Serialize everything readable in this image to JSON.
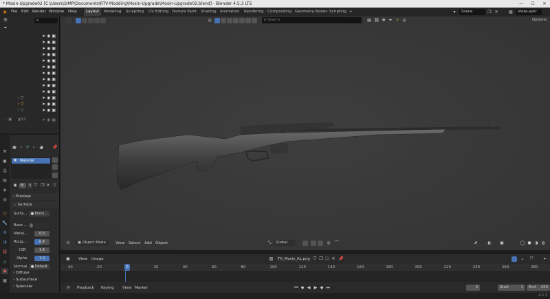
{
  "window": {
    "title": "* Mosin-Upgrade02 [C:\\Users\\SIMP\\Documents\\RTV-Modding\\Mosin-Upgrade\\Mosin-Upgrade02.blend] - Blender 4.5.3 LTS",
    "controls": {
      "minimize": "—",
      "maximize": "☐",
      "close": "✕"
    }
  },
  "menubar": {
    "items": [
      "File",
      "Edit",
      "Render",
      "Window",
      "Help"
    ]
  },
  "workspaces": {
    "tabs": [
      "Layout",
      "Modeling",
      "Sculpting",
      "UV Editing",
      "Texture Paint",
      "Shading",
      "Animation",
      "Rendering",
      "Compositing",
      "Geometry Nodes",
      "Scripting"
    ],
    "active": "Layout",
    "add": "+"
  },
  "scene": {
    "label": "Scene"
  },
  "view_layer": {
    "label": "ViewLayer"
  },
  "outliner": {
    "search_placeholder": "",
    "bottom_item": "gl11"
  },
  "properties": {
    "material_slot": "Material",
    "material_name": "M",
    "material_users": "3",
    "sections": {
      "preview": "Preview",
      "surface": "Surface"
    },
    "surface_label": "Surfa...",
    "surface_value": "Princi...",
    "rows": [
      {
        "label": "Base ...",
        "value": ""
      },
      {
        "label": "Metal...",
        "value": "0.0"
      },
      {
        "label": "Roug...",
        "value": "0.4"
      },
      {
        "label": "IOR",
        "value": "1.4"
      },
      {
        "label": "Alpha",
        "value": "1.0"
      },
      {
        "label": "Normal",
        "value": "Default"
      }
    ],
    "subsections": [
      "Diffuse",
      "Subsurface",
      "Specular"
    ]
  },
  "viewport": {
    "header_search_placeholder": "Search",
    "options_label": "Options",
    "mode": "Object Mode",
    "footer_menus": [
      "View",
      "Select",
      "Add",
      "Object"
    ],
    "orientation": "Global"
  },
  "image_header": {
    "menus": [
      "View",
      "Image"
    ],
    "image_name": "TX_Mosin_AL.png"
  },
  "timeline": {
    "ticks": [
      "-40",
      "-20",
      "0",
      "20",
      "40",
      "60",
      "80",
      "100",
      "120",
      "140",
      "160",
      "180",
      "200",
      "220",
      "240",
      "260",
      "280"
    ],
    "current_frame_marker": "0",
    "menus": [
      "Playback",
      "Keying",
      "View",
      "Marker"
    ],
    "current_frame": "0",
    "start_label": "Start",
    "start_value": "1",
    "end_label": "End",
    "end_value": "250"
  },
  "status": {
    "version": "4.5.3"
  }
}
